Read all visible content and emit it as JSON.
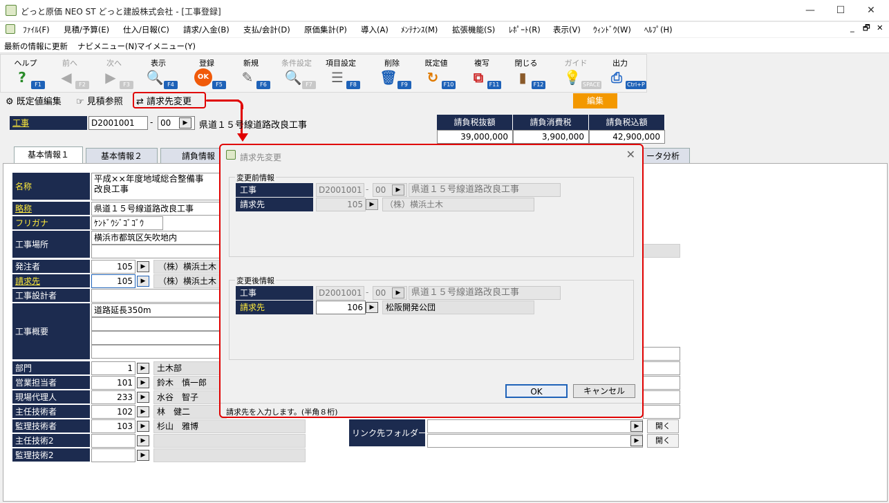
{
  "window": {
    "title": "どっと原価 NEO ST どっと建設株式会社 - [工事登録]",
    "minimize": "—",
    "maximize": "☐",
    "close": "✕",
    "restore_label": "🗗",
    "child_close": "✕",
    "child_min": "_"
  },
  "menu": [
    "ﾌｧｲﾙ(F)",
    "見積/予算(E)",
    "仕入/日報(C)",
    "請求/入金(B)",
    "支払/会計(D)",
    "原価集計(P)",
    "導入(A)",
    "ﾒﾝﾃﾅﾝｽ(M)",
    "拡張機能(S)",
    "ﾚﾎﾟｰﾄ(R)",
    "表示(V)",
    "ｳｨﾝﾄﾞｳ(W)",
    "ﾍﾙﾌﾟ(H)"
  ],
  "toolbar2": [
    "最新の情報に更新",
    "ナビメニュー(N)",
    "マイメニュー(Y)"
  ],
  "tools": [
    {
      "label": "ヘルプ",
      "key": "F1",
      "icon": "?",
      "enabled": true
    },
    {
      "label": "前へ",
      "key": "F2",
      "icon": "◀",
      "enabled": false
    },
    {
      "label": "次へ",
      "key": "F3",
      "icon": "▶",
      "enabled": false
    },
    {
      "label": "表示",
      "key": "F4",
      "icon": "🔍",
      "enabled": true
    },
    {
      "label": "登録",
      "key": "F5",
      "icon": "OK",
      "enabled": true
    },
    {
      "label": "新規",
      "key": "F6",
      "icon": "✎",
      "enabled": true
    },
    {
      "label": "条件設定",
      "key": "F7",
      "icon": "🔍",
      "enabled": false
    },
    {
      "label": "項目設定",
      "key": "F8",
      "icon": "☰",
      "enabled": true
    },
    {
      "label": "削除",
      "key": "F9",
      "icon": "🗑",
      "enabled": true
    },
    {
      "label": "既定値",
      "key": "F10",
      "icon": "↻",
      "enabled": true
    },
    {
      "label": "複写",
      "key": "F11",
      "icon": "⧉",
      "enabled": true
    },
    {
      "label": "閉じる",
      "key": "F12",
      "icon": "▮",
      "enabled": true
    },
    {
      "label": "ガイド",
      "key": "SPACE",
      "icon": "💡",
      "enabled": false
    },
    {
      "label": "出力",
      "key": "Ctrl+P",
      "icon": "⎙",
      "enabled": true
    }
  ],
  "actions": {
    "default_edit": "既定値編集",
    "estimate_ref": "見積参照",
    "billing_change": "請求先変更",
    "edit": "編集"
  },
  "kouji": {
    "label": "工事",
    "code": "D2001001",
    "dash": "-",
    "sub": "00",
    "name": "県道１５号線道路改良工事"
  },
  "summary": {
    "headers": [
      "請負税抜額",
      "請負消費税",
      "請負税込額"
    ],
    "values": [
      "39,000,000",
      "3,900,000",
      "42,900,000"
    ]
  },
  "tabs": [
    "基本情報１",
    "基本情報２",
    "請負情報",
    "ータ分析"
  ],
  "fields": {
    "name_label": "名称",
    "name_value1": "平成××年度地域総合整備事",
    "name_value2": "改良工事",
    "short_label": "略称",
    "short_value": "県道１５号線道路改良工事",
    "kana_label": "フリガナ",
    "kana_value": "ｹﾝﾄﾞｳｼﾞｺﾞｺﾞｳ",
    "place_label": "工事場所",
    "place_value": "横浜市都筑区矢吹地内",
    "orderer_label": "発注者",
    "orderer_code": "105",
    "orderer_name": "（株）横浜土木",
    "billing_label": "請求先",
    "billing_code": "105",
    "billing_name": "（株）横浜土木",
    "designer_label": "工事設計者",
    "overview_label": "工事概要",
    "overview_value": "道路延長350m",
    "dept_label": "部門",
    "dept_code": "1",
    "dept_name": "土木部",
    "sales_label": "営業担当者",
    "sales_code": "101",
    "sales_name": "鈴木　慎一郎",
    "site_label": "現場代理人",
    "site_code": "233",
    "site_name": "水谷　智子",
    "chief_label": "主任技術者",
    "chief_code": "102",
    "chief_name": "林　健二",
    "supervisor_label": "監理技術者",
    "supervisor_code": "103",
    "supervisor_name": "杉山　雅博",
    "chief2_label": "主任技術2",
    "supervisor2_label": "監理技術2",
    "link_label": "リンク先フォルダー",
    "open1": "開く",
    "open2": "開く"
  },
  "dialog": {
    "title": "請求先変更",
    "before_group": "変更前情報",
    "after_group": "変更後情報",
    "kouji_label": "工事",
    "billing_label": "請求先",
    "before": {
      "code": "D2001001",
      "sub": "00",
      "name": "県道１５号線道路改良工事",
      "billing_code": "105",
      "billing_name": "（株）横浜土木"
    },
    "after": {
      "code": "D2001001",
      "sub": "00",
      "name": "県道１５号線道路改良工事",
      "billing_code": "106",
      "billing_name": "松阪開発公団"
    },
    "ok": "OK",
    "cancel": "キャンセル",
    "status": "請求先を入力します。(半角８桁)"
  },
  "colors": {
    "label_bg": "#1c2b4f",
    "highlight": "#e00000",
    "edit_btn": "#f39800",
    "fkey": "#1e62b8"
  }
}
